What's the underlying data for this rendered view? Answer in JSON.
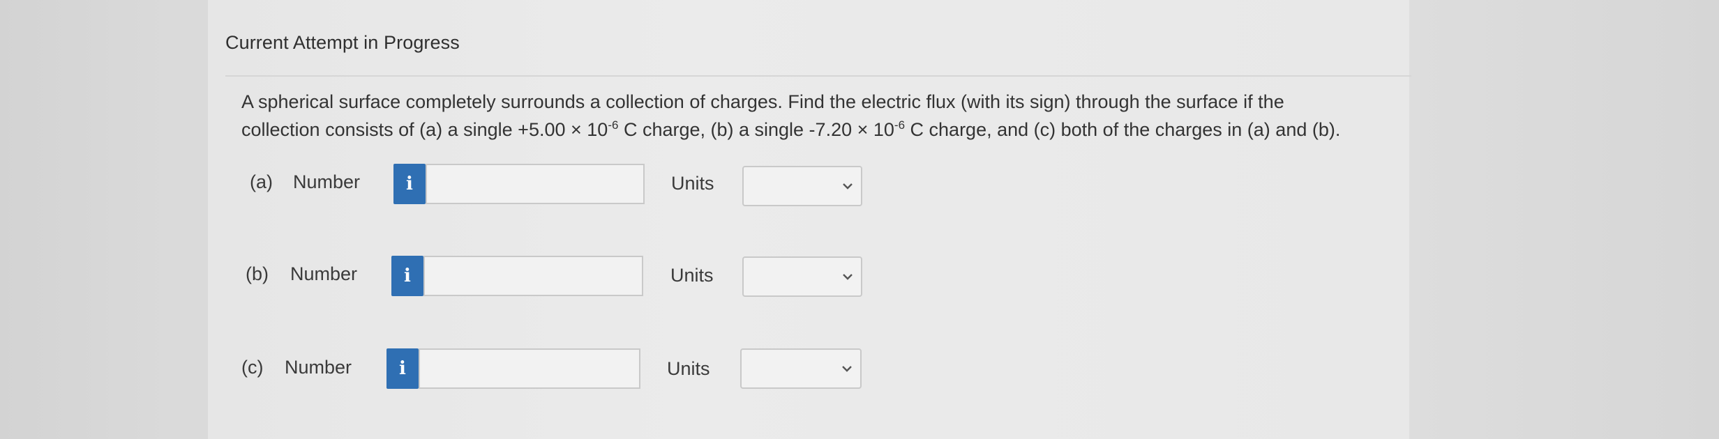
{
  "heading": "Current Attempt in Progress",
  "question": {
    "line1": "A spherical surface completely surrounds a collection of charges. Find the electric flux (with its sign) through the surface if the",
    "line2_pre": "collection consists of (a) a single +5.00 × 10",
    "exp_a": "-6",
    "line2_mid": " C charge, (b) a single -7.20 × 10",
    "exp_b": "-6",
    "line2_post": " C charge, and (c) both of the charges in (a) and (b)."
  },
  "parts": [
    {
      "part_label": "(a)",
      "number_label": "Number",
      "info_icon": "i",
      "number_value": "",
      "units_label": "Units",
      "units_value": ""
    },
    {
      "part_label": "(b)",
      "number_label": "Number",
      "info_icon": "i",
      "number_value": "",
      "units_label": "Units",
      "units_value": ""
    },
    {
      "part_label": "(c)",
      "number_label": "Number",
      "info_icon": "i",
      "number_value": "",
      "units_label": "Units",
      "units_value": ""
    }
  ],
  "colors": {
    "info_button": "#2f6fb3",
    "input_bg": "#f2f2f2",
    "input_border": "#c9c9c9"
  }
}
